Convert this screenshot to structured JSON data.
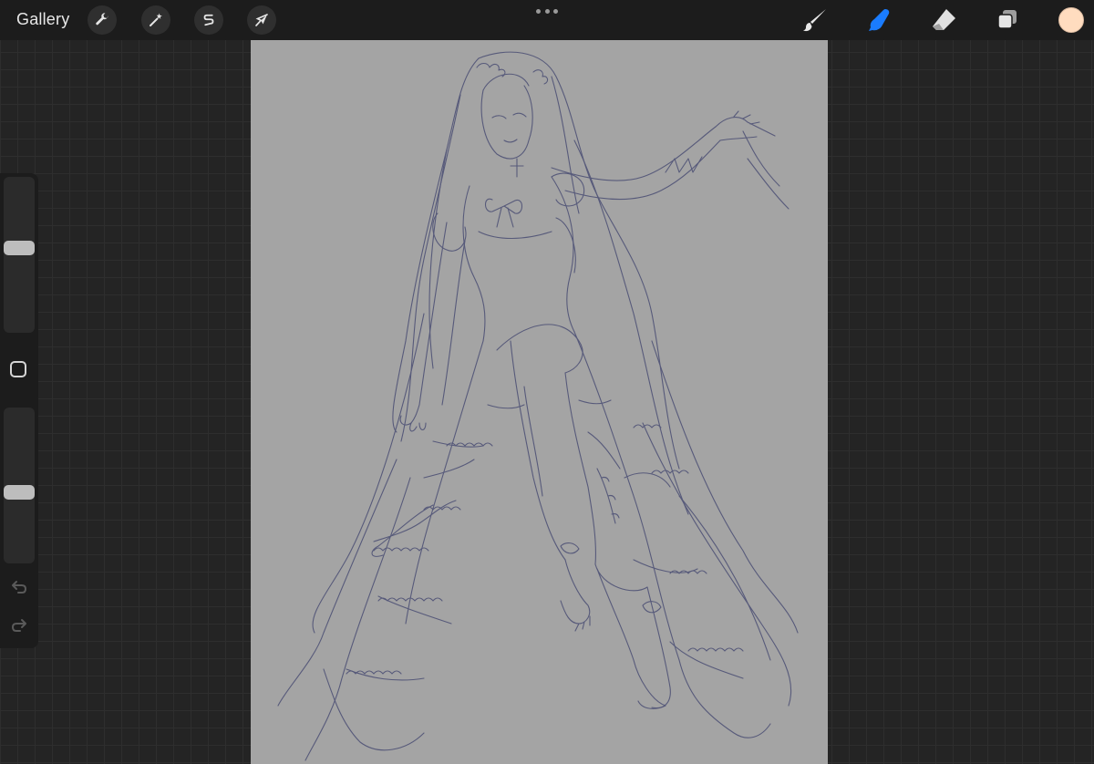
{
  "toolbar": {
    "gallery_label": "Gallery",
    "actions_icon": "wrench-icon",
    "adjustments_icon": "magic-wand-icon",
    "selection_icon": "selection-s-icon",
    "transform_icon": "arrow-cursor-icon",
    "more_icon": "ellipsis-icon",
    "brush_icon": "brush-icon",
    "smudge_icon": "smudge-finger-icon",
    "smudge_active_color": "#1a7cff",
    "eraser_icon": "eraser-icon",
    "layers_icon": "layers-icon",
    "current_color": "#ffdcbf"
  },
  "sidebar": {
    "brush_size_level": 0.55,
    "opacity_level": 0.45,
    "modify_icon": "square-modify-icon",
    "undo_icon": "undo-icon",
    "redo_icon": "redo-icon"
  },
  "canvas": {
    "background": "#a4a4a4",
    "stroke_color": "#4f5276",
    "subject": "sketch-of-seated-girl-in-veil-and-lace-dress"
  }
}
